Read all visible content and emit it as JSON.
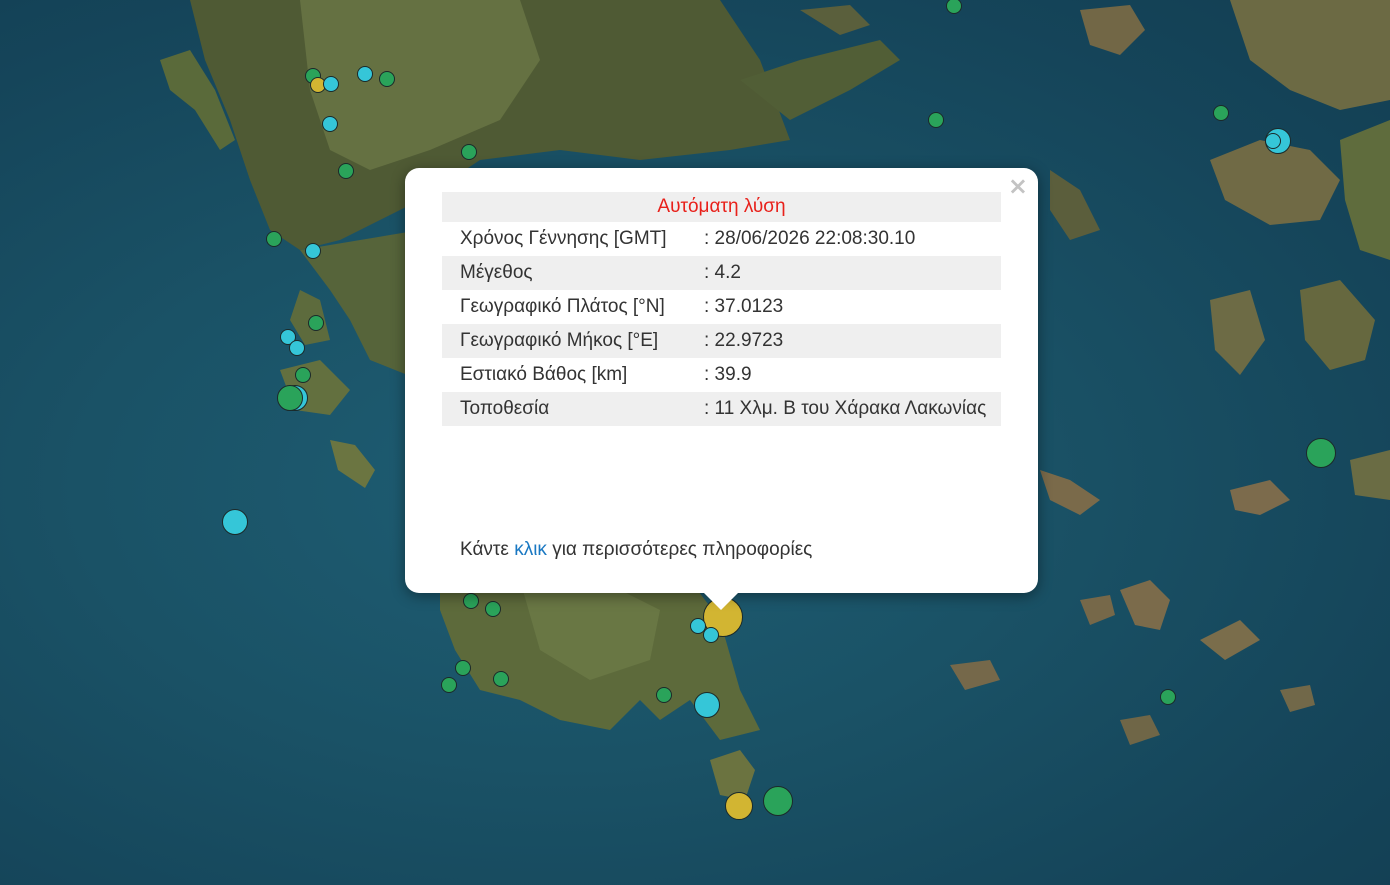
{
  "popup": {
    "header": "Αυτόματη λύση",
    "close_label": "×",
    "rows": [
      {
        "label": "Χρόνος Γέννησης [GMT]",
        "value": ": 28/06/2026 22:08:30.10"
      },
      {
        "label": "Μέγεθος",
        "value": ": 4.2"
      },
      {
        "label": "Γεωγραφικό Πλάτος [°N]",
        "value": ": 37.0123"
      },
      {
        "label": "Γεωγραφικό Μήκος [°E]",
        "value": ": 22.9723"
      },
      {
        "label": "Εστιακό Βάθος [km]",
        "value": ": 39.9"
      },
      {
        "label": "Τοποθεσία",
        "value": ": 11 Χλμ. Β του Χάρακα Λακωνίας"
      }
    ],
    "more_prefix": "Κάντε ",
    "more_link": "κλικ",
    "more_suffix": " για περισσότερες πληροφορίες"
  },
  "colors": {
    "green": "#2aa35a",
    "cyan": "#35c6d8",
    "yellow": "#d2b532",
    "sea": "#1a5266",
    "land": "#5f6e3e",
    "header_red": "#e8211b",
    "link_blue": "#1a78c2"
  }
}
